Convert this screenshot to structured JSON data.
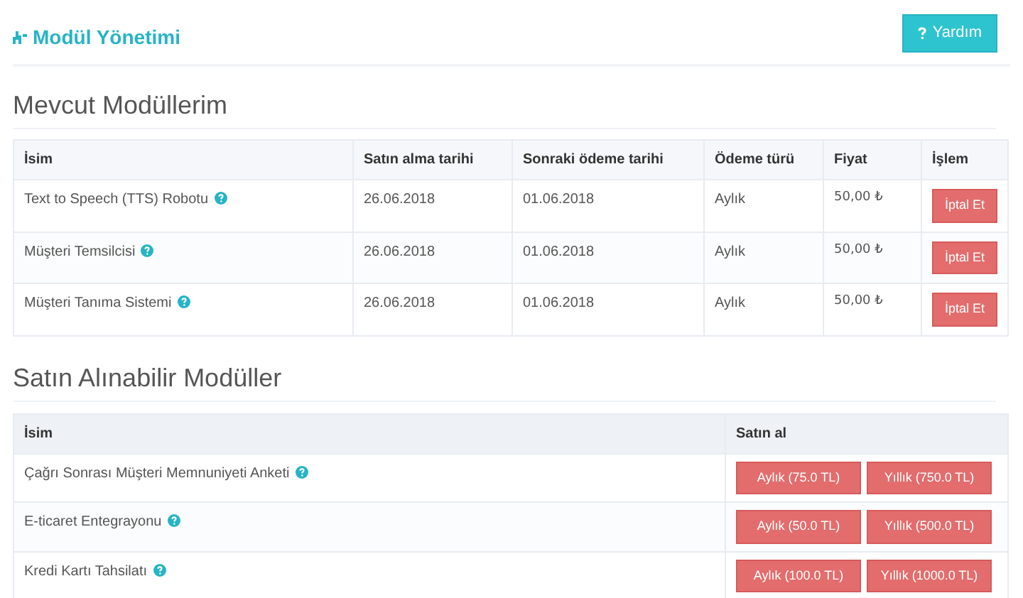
{
  "header": {
    "title": "Modül Yönetimi",
    "help_button": "Yardım"
  },
  "current": {
    "title": "Mevcut Modüllerim",
    "columns": [
      "İsim",
      "Satın alma tarihi",
      "Sonraki ödeme tarihi",
      "Ödeme türü",
      "Fiyat",
      "İşlem"
    ],
    "rows": [
      {
        "name": "Text to Speech (TTS) Robotu",
        "purchased": "26.06.2018",
        "next_payment": "01.06.2018",
        "payment_type": "Aylık",
        "price": "50,00 ₺",
        "action": "İptal Et"
      },
      {
        "name": "Müşteri Temsilcisi",
        "purchased": "26.06.2018",
        "next_payment": "01.06.2018",
        "payment_type": "Aylık",
        "price": "50,00 ₺",
        "action": "İptal Et"
      },
      {
        "name": "Müşteri Tanıma Sistemi",
        "purchased": "26.06.2018",
        "next_payment": "01.06.2018",
        "payment_type": "Aylık",
        "price": "50,00 ₺",
        "action": "İptal Et"
      }
    ]
  },
  "available": {
    "title": "Satın Alınabilir Modüller",
    "columns": [
      "İsim",
      "Satın al"
    ],
    "rows": [
      {
        "name": "Çağrı Sonrası Müşteri Memnuniyeti Anketi",
        "monthly": "Aylık (75.0 TL)",
        "yearly": "Yıllık (750.0 TL)"
      },
      {
        "name": "E-ticaret Entegrayonu",
        "monthly": "Aylık (50.0 TL)",
        "yearly": "Yıllık (500.0 TL)"
      },
      {
        "name": "Kredi Kartı Tahsilatı",
        "monthly": "Aylık (100.0 TL)",
        "yearly": "Yıllık (1000.0 TL)"
      }
    ]
  }
}
